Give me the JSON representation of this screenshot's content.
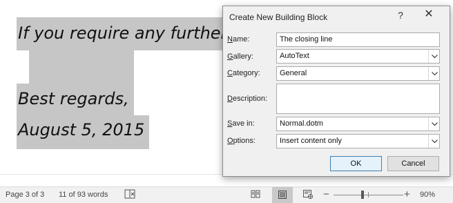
{
  "document": {
    "line1": "If you require any further",
    "line2": "Best regards,",
    "line3": "August 5, 2015"
  },
  "status_bar": {
    "page": "Page 3 of 3",
    "words": "11 of 93 words",
    "zoom": "90%",
    "zoom_minus": "−",
    "zoom_plus": "+"
  },
  "dialog": {
    "title": "Create New Building Block",
    "help": "?",
    "close": "✕",
    "fields": {
      "name": {
        "label_prefix": "",
        "label_key": "N",
        "label_rest": "ame:",
        "value": "The closing line"
      },
      "gallery": {
        "label_prefix": "",
        "label_key": "G",
        "label_rest": "allery:",
        "value": "AutoText"
      },
      "category": {
        "label_prefix": "",
        "label_key": "C",
        "label_rest": "ategory:",
        "value": "General"
      },
      "description": {
        "label_prefix": "",
        "label_key": "D",
        "label_rest": "escription:",
        "value": ""
      },
      "save_in": {
        "label_prefix": "",
        "label_key": "S",
        "label_rest": "ave in:",
        "value": "Normal.dotm"
      },
      "options": {
        "label_prefix": "",
        "label_key": "O",
        "label_rest": "ptions:",
        "value": "Insert content only"
      }
    },
    "ok_label": "OK",
    "cancel_label": "Cancel"
  },
  "colors": {
    "selection_highlight": "#c6c6c6",
    "dialog_bg": "#f0f0f0",
    "ok_border": "#3c7fb1"
  }
}
